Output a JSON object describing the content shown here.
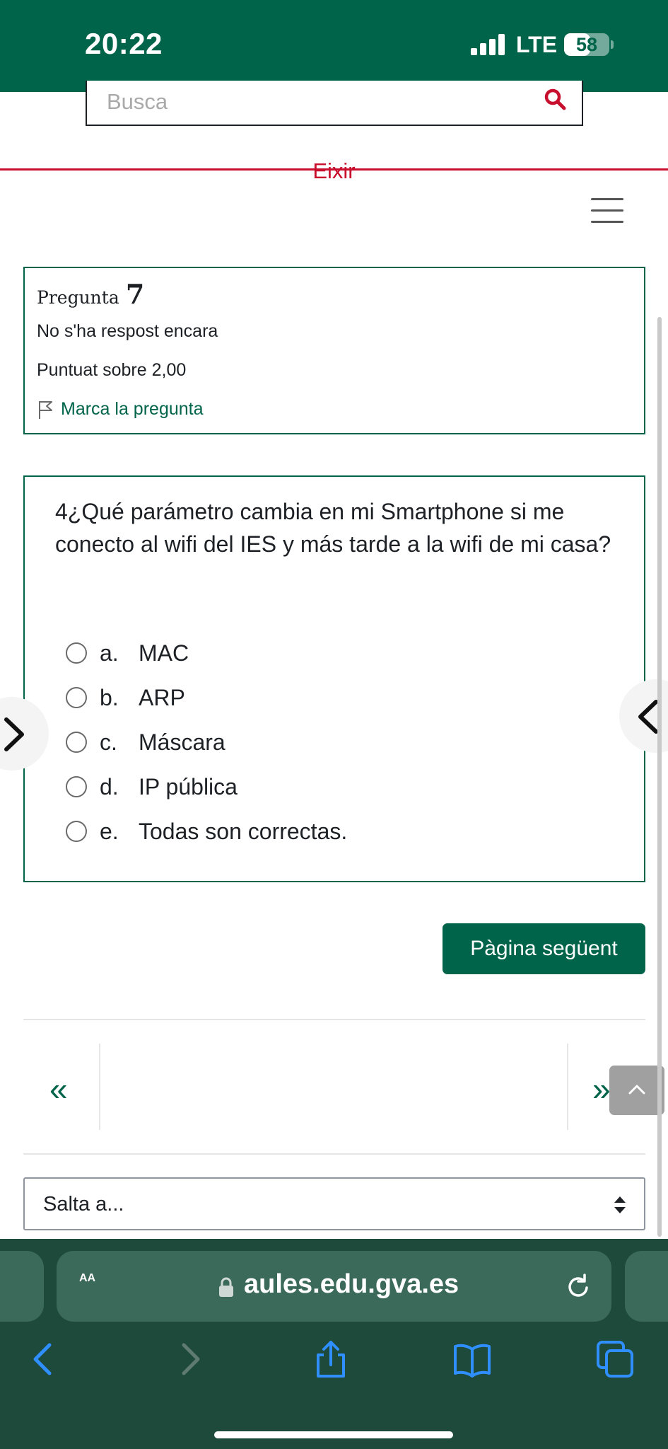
{
  "status_bar": {
    "time": "20:22",
    "network": "LTE",
    "battery": "58",
    "battery_level": 0.58
  },
  "header": {
    "search_placeholder": "Busca",
    "exit_label": "Eixir"
  },
  "question_info": {
    "label": "Pregunta",
    "number": "7",
    "state": "No s'ha respost encara",
    "grade": "Puntuat sobre 2,00",
    "flag_label": "Marca la pregunta"
  },
  "question": {
    "text": "4¿Qué parámetro cambia en mi Smartphone si me conecto al wifi del IES y más tarde a la wifi de mi casa?",
    "options": [
      {
        "letter": "a.",
        "text": "MAC"
      },
      {
        "letter": "b.",
        "text": "ARP"
      },
      {
        "letter": "c.",
        "text": "Máscara"
      },
      {
        "letter": "d.",
        "text": "IP pública"
      },
      {
        "letter": "e.",
        "text": "Todas son correctas."
      }
    ]
  },
  "buttons": {
    "next_page": "Pàgina següent"
  },
  "navigation": {
    "prev_symbol": "«",
    "next_symbol": "»",
    "jump_label": "Salta a..."
  },
  "browser": {
    "text_size": "AA",
    "url": "aules.edu.gva.es"
  },
  "colors": {
    "brand_green": "#00644a",
    "exit_red": "#c8102e",
    "safari_bg": "#1e4a3c",
    "ios_blue": "#2f8fff"
  }
}
